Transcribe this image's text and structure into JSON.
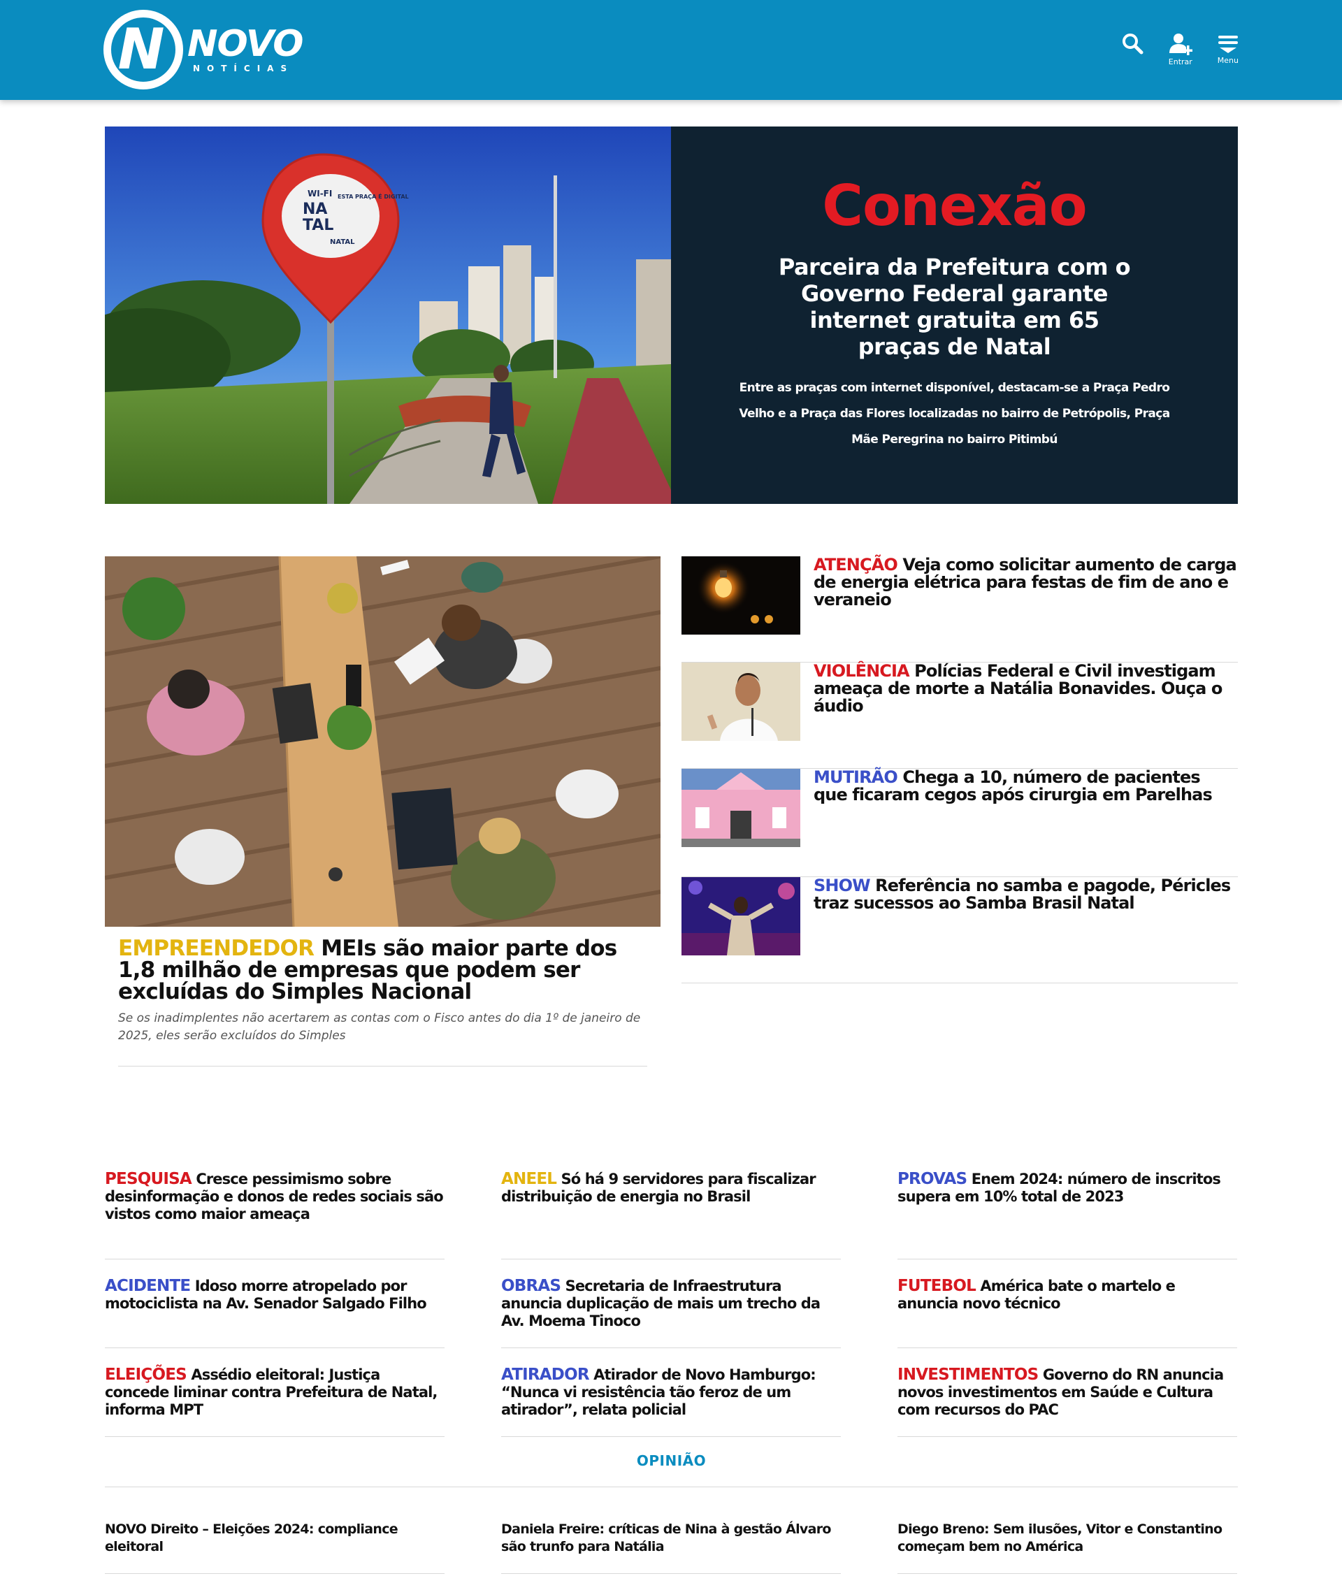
{
  "header": {
    "logo_word": "NOVO",
    "logo_sub": "NOTÍCIAS",
    "search_icon": "search-icon",
    "login_label": "Entrar",
    "menu_label": "Menu",
    "bg_color": "#0a8cbf"
  },
  "hero": {
    "kicker": "Conexão",
    "title": "Parceira da Prefeitura com o Governo Federal garante internet gratuita em 65 praças de Natal",
    "description": "Entre as praças com internet disponível, destacam-se a Praça Pedro Velho e a Praça das Flores localizadas no bairro de Petrópolis, Praça Mãe Peregrina no bairro Pitimbú",
    "sign_line1": "WI-FI",
    "sign_line2": "NA",
    "sign_line3": "TAL",
    "sign_line4": "ESTA PRAÇA É DIGITAL",
    "sign_line5": "NATAL",
    "panel_color": "#0f2231",
    "kicker_color": "#e31b23"
  },
  "featured": {
    "kicker": "EMPREENDEDOR",
    "title": "MEIs são maior parte dos 1,8 milhão de empresas que podem ser excluídas do Simples Nacional",
    "description": "Se os inadimplentes não acertarem as contas com o Fisco antes do dia 1º de janeiro de 2025, eles serão excluídos do Simples"
  },
  "side_news": [
    {
      "kicker": "ATENÇÃO",
      "title": "Veja como solicitar aumento de carga de energia elétrica para festas de fim de ano e veraneio"
    },
    {
      "kicker": "VIOLÊNCIA",
      "title": "Polícias Federal e Civil investigam ameaça de morte a Natália Bonavides. Ouça o áudio"
    },
    {
      "kicker": "MUTIRÃO",
      "title": "Chega a 10, número de pacientes que ficaram cegos após cirurgia em Parelhas"
    },
    {
      "kicker": "SHOW",
      "title": "Referência no samba e pagode, Péricles traz sucessos ao Samba Brasil Natal"
    }
  ],
  "grid_news": [
    {
      "kicker": "PESQUISA",
      "title": "Cresce pessimismo sobre desinformação e donos de redes sociais são vistos como maior ameaça"
    },
    {
      "kicker": "ANEEL",
      "title": "Só há 9 servidores para fiscalizar distribuição de energia no Brasil"
    },
    {
      "kicker": "PROVAS",
      "title": "Enem 2024: número de inscritos supera em 10% total de 2023"
    },
    {
      "kicker": "ACIDENTE",
      "title": "Idoso morre atropelado por motociclista na Av. Senador Salgado Filho"
    },
    {
      "kicker": "OBRAS",
      "title": "Secretaria de Infraestrutura anuncia duplicação de mais um trecho da Av. Moema Tinoco"
    },
    {
      "kicker": "FUTEBOL",
      "title": "América bate o martelo e anuncia novo técnico"
    },
    {
      "kicker": "ELEIÇÕES",
      "title": "Assédio eleitoral: Justiça concede liminar contra Prefeitura de Natal, informa MPT"
    },
    {
      "kicker": "ATIRADOR",
      "title": "Atirador de Novo Hamburgo: “Nunca vi resistência tão feroz de um atirador”, relata policial"
    },
    {
      "kicker": "INVESTIMENTOS",
      "title": "Governo do RN anuncia novos investimentos em Saúde e Cultura com recursos do PAC"
    }
  ],
  "opiniao": {
    "heading": "OPINIÃO",
    "items": [
      "NOVO Direito – Eleições 2024: compliance eleitoral",
      "Daniela Freire: críticas de Nina à gestão Álvaro são trunfo para Natália",
      "Diego Breno: Sem ilusões, Vitor e Constantino começam bem no América"
    ]
  },
  "colors": {
    "red": "#d71920",
    "yellow": "#e3b40f",
    "blue": "#3a4fc8",
    "opiniao": "#0a8cbf"
  }
}
